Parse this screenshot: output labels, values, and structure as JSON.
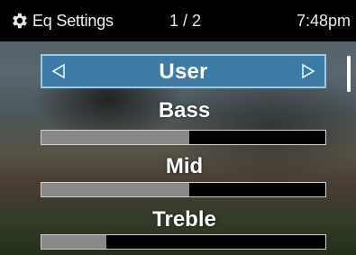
{
  "header": {
    "icon": "gear-icon",
    "title": "Eq Settings",
    "page_indicator": "1 / 2",
    "time": "7:48pm"
  },
  "preset_selector": {
    "value": "User",
    "prev_icon": "triangle-left-icon",
    "next_icon": "triangle-right-icon",
    "accent_color": "#3d7aa6"
  },
  "sliders": [
    {
      "label": "Bass",
      "level": 0.52
    },
    {
      "label": "Mid",
      "level": 0.52
    },
    {
      "label": "Treble",
      "level": 0.23
    }
  ]
}
